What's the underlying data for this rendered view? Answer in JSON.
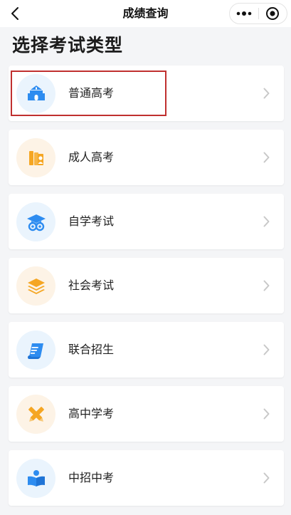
{
  "navbar": {
    "title": "成绩查询",
    "back_icon": "chevron-left-icon",
    "menu_icon": "more-dots-icon",
    "close_icon": "target-circle-icon"
  },
  "page": {
    "title": "选择考试类型"
  },
  "colors": {
    "blue": "#2d8cf0",
    "orange": "#f5a623",
    "highlight": "#c0302f"
  },
  "exam_types": [
    {
      "label": "普通高考",
      "icon": "school-building-icon",
      "color": "blue",
      "highlighted": true
    },
    {
      "label": "成人高考",
      "icon": "books-person-icon",
      "color": "orange",
      "highlighted": false
    },
    {
      "label": "自学考试",
      "icon": "graduation-owl-icon",
      "color": "blue",
      "highlighted": false
    },
    {
      "label": "社会考试",
      "icon": "layers-icon",
      "color": "orange",
      "highlighted": false
    },
    {
      "label": "联合招生",
      "icon": "scroll-icon",
      "color": "blue",
      "highlighted": false
    },
    {
      "label": "高中学考",
      "icon": "crossed-pencils-icon",
      "color": "orange",
      "highlighted": false
    },
    {
      "label": "中招中考",
      "icon": "reading-book-icon",
      "color": "blue",
      "highlighted": false
    }
  ]
}
